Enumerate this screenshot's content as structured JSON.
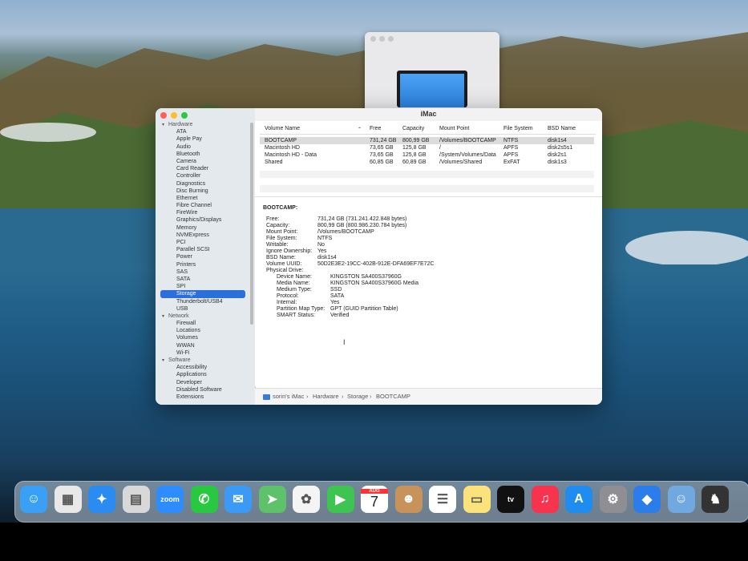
{
  "window": {
    "title": "iMac",
    "lights": [
      "#fe5f57",
      "#febc2e",
      "#28c840"
    ]
  },
  "sidebar": {
    "groups": [
      {
        "label": "Hardware",
        "items": [
          "ATA",
          "Apple Pay",
          "Audio",
          "Bluetooth",
          "Camera",
          "Card Reader",
          "Controller",
          "Diagnostics",
          "Disc Burning",
          "Ethernet",
          "Fibre Channel",
          "FireWire",
          "Graphics/Displays",
          "Memory",
          "NVMExpress",
          "PCI",
          "Parallel SCSI",
          "Power",
          "Printers",
          "SAS",
          "SATA",
          "SPI",
          "Storage",
          "Thunderbolt/USB4",
          "USB"
        ]
      },
      {
        "label": "Network",
        "items": [
          "Firewall",
          "Locations",
          "Volumes",
          "WWAN",
          "Wi-Fi"
        ]
      },
      {
        "label": "Software",
        "items": [
          "Accessibility",
          "Applications",
          "Developer",
          "Disabled Software",
          "Extensions"
        ]
      }
    ],
    "selected": "Storage"
  },
  "table": {
    "columns": [
      "Volume Name",
      "Free",
      "Capacity",
      "Mount Point",
      "File System",
      "BSD Name"
    ],
    "rows": [
      [
        "BOOTCAMP",
        "731,24 GB",
        "800,99 GB",
        "/Volumes/BOOTCAMP",
        "NTFS",
        "disk1s4"
      ],
      [
        "Macintosh HD",
        "73,65 GB",
        "125,8 GB",
        "/",
        "APFS",
        "disk2s5s1"
      ],
      [
        "Macintosh HD - Data",
        "73,65 GB",
        "125,8 GB",
        "/System/Volumes/Data",
        "APFS",
        "disk2s1"
      ],
      [
        "Shared",
        "60,85 GB",
        "60,89 GB",
        "/Volumes/Shared",
        "ExFAT",
        "disk1s3"
      ]
    ],
    "selected_row": 0
  },
  "details": {
    "heading": "BOOTCAMP:",
    "fields": [
      {
        "k": "Free:",
        "v": "731,24 GB (731.241.422.848 bytes)"
      },
      {
        "k": "Capacity:",
        "v": "800,99 GB (800.986.230.784 bytes)"
      },
      {
        "k": "Mount Point:",
        "v": "/Volumes/BOOTCAMP"
      },
      {
        "k": "File System:",
        "v": "NTFS"
      },
      {
        "k": "Writable:",
        "v": "No"
      },
      {
        "k": "Ignore Ownership:",
        "v": "Yes"
      },
      {
        "k": "BSD Name:",
        "v": "disk1s4"
      },
      {
        "k": "Volume UUID:",
        "v": "50D2E3E2-19CC-402B-912E-DFA69EF7E72C"
      },
      {
        "k": "Physical Drive:",
        "v": ""
      }
    ],
    "drive": [
      {
        "k": "Device Name:",
        "v": "KINGSTON SA400S37960G"
      },
      {
        "k": "Media Name:",
        "v": "KINGSTON SA400S37960G Media"
      },
      {
        "k": "Medium Type:",
        "v": "SSD"
      },
      {
        "k": "Protocol:",
        "v": "SATA"
      },
      {
        "k": "Internal:",
        "v": "Yes"
      },
      {
        "k": "Partition Map Type:",
        "v": "GPT (GUID Partition Table)"
      },
      {
        "k": "SMART Status:",
        "v": "Verified"
      }
    ]
  },
  "breadcrumb": [
    "sorin's iMac",
    "Hardware",
    "Storage",
    "BOOTCAMP"
  ],
  "dock": [
    {
      "name": "finder-icon",
      "color": "#3aa0f5",
      "glyph": "☺"
    },
    {
      "name": "launchpad-icon",
      "color": "#e8e8e8",
      "glyph": "▦"
    },
    {
      "name": "safari-icon",
      "color": "#2a8cf0",
      "glyph": "✦"
    },
    {
      "name": "calculator-icon",
      "color": "#d8d8d8",
      "glyph": "▤"
    },
    {
      "name": "zoom-icon",
      "color": "#2d8cff",
      "glyph": "zoom"
    },
    {
      "name": "whatsapp-icon",
      "color": "#28c840",
      "glyph": "✆"
    },
    {
      "name": "mail-icon",
      "color": "#3a9af5",
      "glyph": "✉"
    },
    {
      "name": "maps-icon",
      "color": "#5ec26a",
      "glyph": "➤"
    },
    {
      "name": "photos-icon",
      "color": "#f4f4f4",
      "glyph": "✿"
    },
    {
      "name": "facetime-icon",
      "color": "#3ec450",
      "glyph": "▶"
    },
    {
      "name": "calendar-icon",
      "color": "#ffffff",
      "glyph": "7"
    },
    {
      "name": "contacts-icon",
      "color": "#c8935a",
      "glyph": "☻"
    },
    {
      "name": "reminders-icon",
      "color": "#ffffff",
      "glyph": "☰"
    },
    {
      "name": "notes-icon",
      "color": "#fbe27a",
      "glyph": "▭"
    },
    {
      "name": "apple-tv-icon",
      "color": "#111111",
      "glyph": "tv"
    },
    {
      "name": "music-icon",
      "color": "#f8334e",
      "glyph": "♫"
    },
    {
      "name": "app-store-icon",
      "color": "#1f8cf0",
      "glyph": "A"
    },
    {
      "name": "system-preferences-icon",
      "color": "#8e8e93",
      "glyph": "⚙"
    },
    {
      "name": "roblox-icon",
      "color": "#2b7de9",
      "glyph": "◆"
    },
    {
      "name": "finder-alt-icon",
      "color": "#6fa9e0",
      "glyph": "☺"
    },
    {
      "name": "chess-icon",
      "color": "#333333",
      "glyph": "♞"
    }
  ],
  "calendar_month": "AUG"
}
